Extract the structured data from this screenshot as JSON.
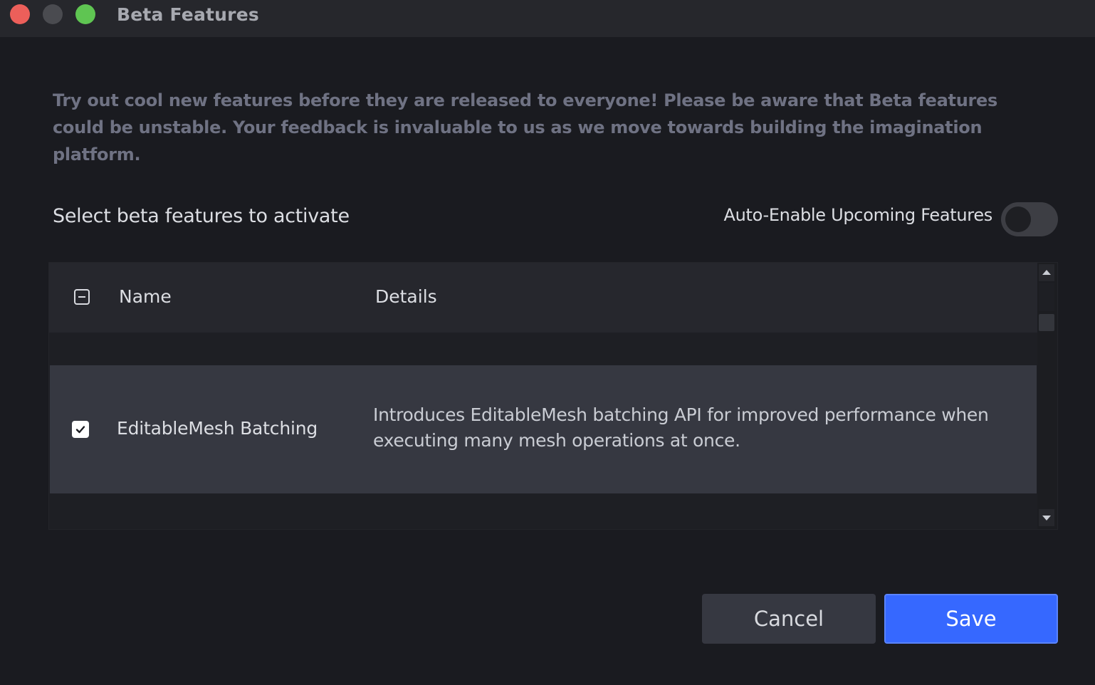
{
  "window": {
    "title": "Beta Features"
  },
  "intro_text": "Try out cool new features before they are released to everyone! Please be aware that Beta features could be unstable. Your feedback is invaluable to us as we move towards building the imagination platform.",
  "section": {
    "label": "Select beta features to activate",
    "auto_enable_label": "Auto-Enable Upcoming Features",
    "auto_enable_on": false
  },
  "table": {
    "columns": [
      "Name",
      "Details"
    ],
    "header_checkbox_state": "indeterminate",
    "rows": [
      {
        "checked": true,
        "name": "EditableMesh Batching",
        "details": "Introduces EditableMesh batching API for improved performance when executing many mesh operations at once."
      }
    ]
  },
  "buttons": {
    "cancel": "Cancel",
    "save": "Save"
  },
  "colors": {
    "accent": "#3668ff",
    "background": "#1a1b20",
    "selected_row": "#363841"
  }
}
